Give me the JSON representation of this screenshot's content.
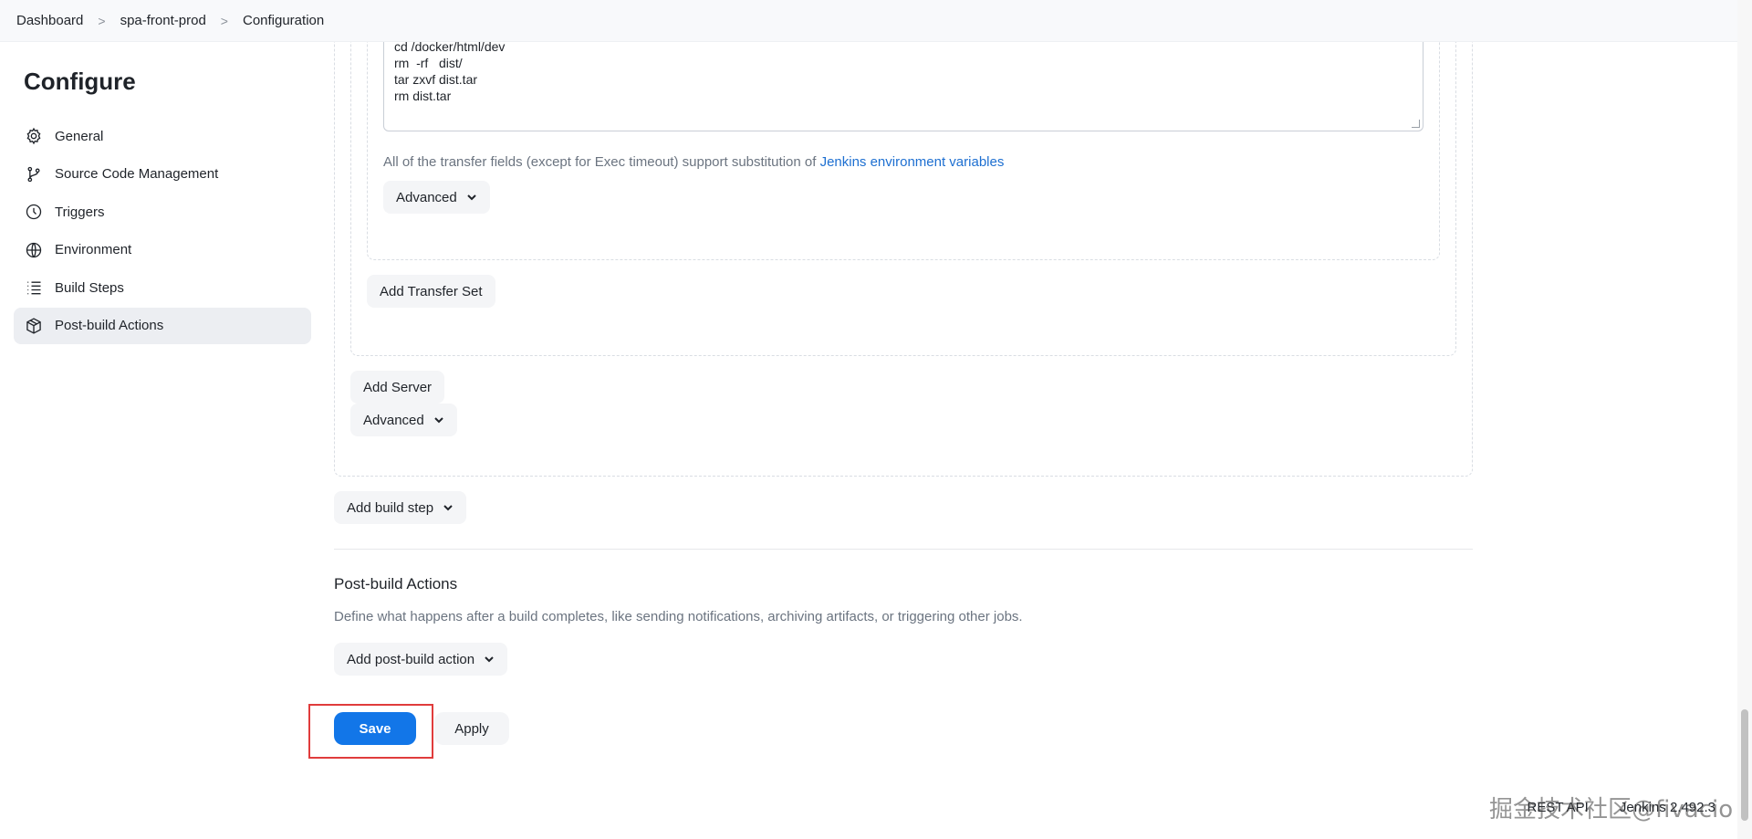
{
  "breadcrumb": {
    "items": [
      "Dashboard",
      "spa-front-prod",
      "Configuration"
    ],
    "separator": ">"
  },
  "sidebar": {
    "title": "Configure",
    "items": [
      {
        "label": "General",
        "icon": "gear-icon"
      },
      {
        "label": "Source Code Management",
        "icon": "branch-icon"
      },
      {
        "label": "Triggers",
        "icon": "clock-icon"
      },
      {
        "label": "Environment",
        "icon": "globe-icon"
      },
      {
        "label": "Build Steps",
        "icon": "list-icon"
      },
      {
        "label": "Post-build Actions",
        "icon": "package-icon",
        "active": true
      }
    ]
  },
  "exec_command": {
    "value": "cd /docker/html/dev\nrm  -rf   dist/\ntar zxvf dist.tar\nrm dist.tar"
  },
  "transfer_help": {
    "text": "All of the transfer fields (except for Exec timeout) support substitution of ",
    "link": "Jenkins environment variables"
  },
  "buttons": {
    "advanced_transfer": "Advanced",
    "add_transfer_set": "Add Transfer Set",
    "add_server": "Add Server",
    "advanced_server": "Advanced",
    "add_build_step": "Add build step",
    "add_post_build_action": "Add post-build action",
    "save": "Save",
    "apply": "Apply"
  },
  "post_build": {
    "title": "Post-build Actions",
    "description": "Define what happens after a build completes, like sending notifications, archiving artifacts, or triggering other jobs."
  },
  "footer": {
    "rest_api": "REST API",
    "version": "Jenkins 2.492.3"
  },
  "watermark": "掘金技术社区@fivacio",
  "colors": {
    "primary": "#1276e8",
    "highlight": "#e03c3c",
    "link": "#1d6fd1"
  }
}
